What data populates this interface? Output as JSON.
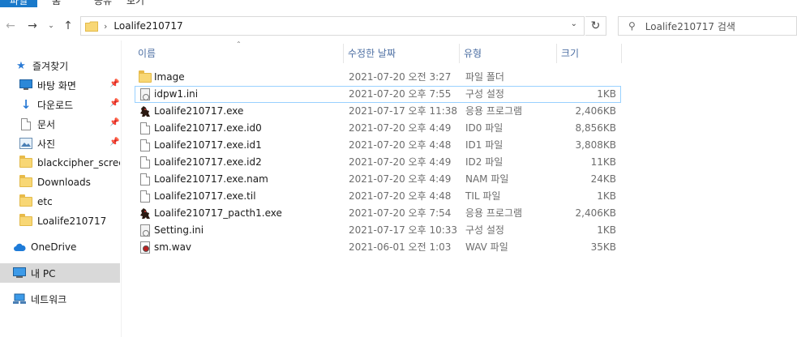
{
  "ribbon": {
    "tabs": [
      "파일",
      "홈",
      "공유",
      "보기"
    ]
  },
  "address": {
    "crumb": "Loalife210717",
    "search_placeholder": "Loalife210717 검색"
  },
  "nav": {
    "quick_access": "즐겨찾기",
    "pinned": [
      "바탕 화면",
      "다운로드",
      "문서",
      "사진"
    ],
    "folders": [
      "blackcipher_screens",
      "Downloads",
      "etc",
      "Loalife210717"
    ],
    "onedrive": "OneDrive",
    "this_pc": "내 PC",
    "network": "네트워크"
  },
  "columns": {
    "name": "이름",
    "date": "수정한 날짜",
    "type": "유형",
    "size": "크기"
  },
  "files": [
    {
      "name": "Image",
      "date": "2021-07-20 오전 3:27",
      "type": "파일 폴더",
      "size": "",
      "icon": "folder"
    },
    {
      "name": "idpw1.ini",
      "date": "2021-07-20 오후 7:55",
      "type": "구성 설정",
      "size": "1KB",
      "icon": "ini"
    },
    {
      "name": "Loalife210717.exe",
      "date": "2021-07-17 오후 11:38",
      "type": "응용 프로그램",
      "size": "2,406KB",
      "icon": "exe"
    },
    {
      "name": "Loalife210717.exe.id0",
      "date": "2021-07-20 오후 4:49",
      "type": "ID0 파일",
      "size": "8,856KB",
      "icon": "doc"
    },
    {
      "name": "Loalife210717.exe.id1",
      "date": "2021-07-20 오후 4:48",
      "type": "ID1 파일",
      "size": "3,808KB",
      "icon": "doc"
    },
    {
      "name": "Loalife210717.exe.id2",
      "date": "2021-07-20 오후 4:49",
      "type": "ID2 파일",
      "size": "11KB",
      "icon": "doc"
    },
    {
      "name": "Loalife210717.exe.nam",
      "date": "2021-07-20 오후 4:49",
      "type": "NAM 파일",
      "size": "24KB",
      "icon": "doc"
    },
    {
      "name": "Loalife210717.exe.til",
      "date": "2021-07-20 오후 4:48",
      "type": "TIL 파일",
      "size": "1KB",
      "icon": "doc"
    },
    {
      "name": "Loalife210717_pacth1.exe",
      "date": "2021-07-20 오후 7:54",
      "type": "응용 프로그램",
      "size": "2,406KB",
      "icon": "exe"
    },
    {
      "name": "Setting.ini",
      "date": "2021-07-17 오후 10:33",
      "type": "구성 설정",
      "size": "1KB",
      "icon": "ini"
    },
    {
      "name": "sm.wav",
      "date": "2021-06-01 오전 1:03",
      "type": "WAV 파일",
      "size": "35KB",
      "icon": "wav"
    }
  ],
  "colors": {
    "accent": "#1979ca",
    "selected_bg": "#cce8ff",
    "header_text": "#4d6fa3"
  }
}
